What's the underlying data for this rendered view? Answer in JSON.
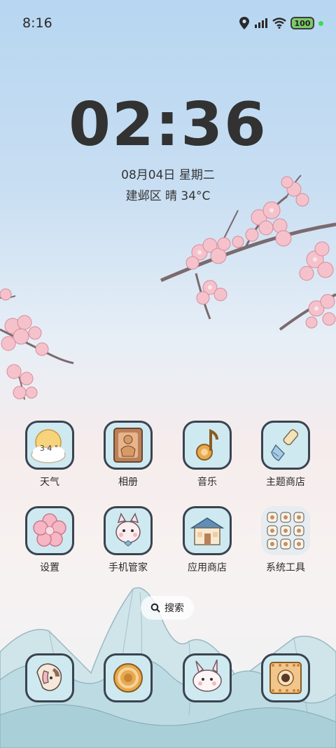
{
  "status": {
    "time": "8:16",
    "battery": "100",
    "icons": [
      "location-icon",
      "signal-icon",
      "wifi-icon",
      "battery-icon"
    ]
  },
  "lock_clock": {
    "time": "02:36",
    "date": "08月04日 星期二",
    "weather": "建邺区 晴 34°C"
  },
  "apps_row1": [
    {
      "label": "天气",
      "icon": "weather-icon"
    },
    {
      "label": "相册",
      "icon": "gallery-icon"
    },
    {
      "label": "音乐",
      "icon": "music-icon"
    },
    {
      "label": "主题商店",
      "icon": "theme-store-icon"
    }
  ],
  "apps_row2": [
    {
      "label": "设置",
      "icon": "settings-flower-icon"
    },
    {
      "label": "手机管家",
      "icon": "phone-manager-icon"
    },
    {
      "label": "应用商店",
      "icon": "app-store-icon"
    },
    {
      "label": "系统工具",
      "icon": "system-tools-folder-icon"
    }
  ],
  "weather_icon_text": "3 4 °",
  "search": {
    "label": "搜索"
  },
  "dock": [
    {
      "icon": "phone-icon"
    },
    {
      "icon": "browser-icon"
    },
    {
      "icon": "messages-icon"
    },
    {
      "icon": "camera-icon"
    }
  ]
}
